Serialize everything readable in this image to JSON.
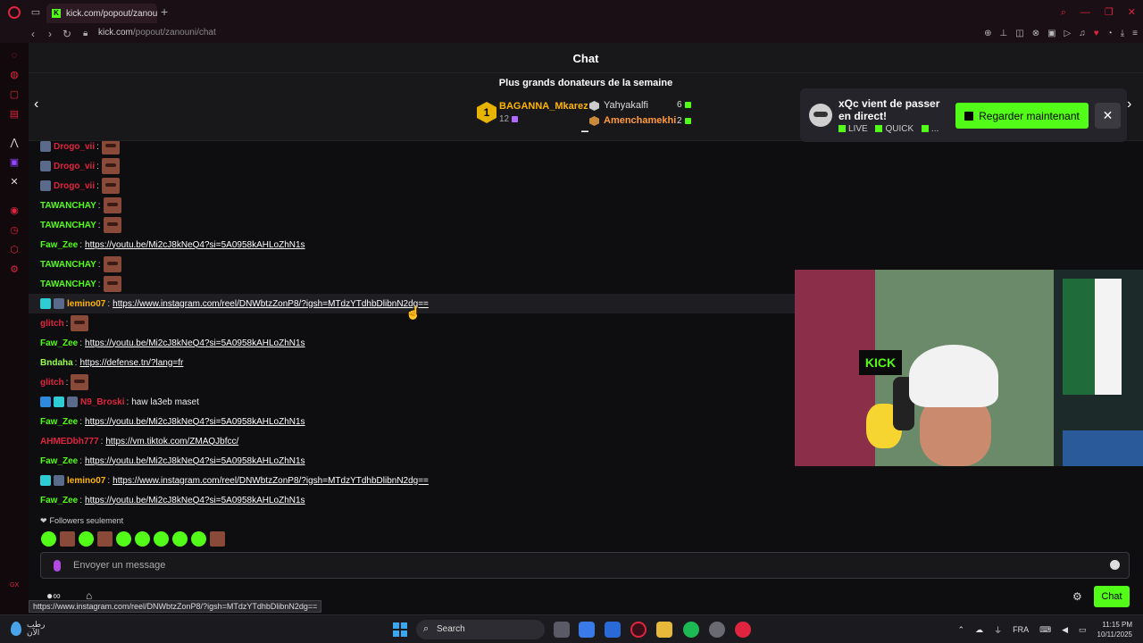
{
  "browser": {
    "tab_title": "kick.com/popout/zanouni",
    "tab_icon_letter": "K",
    "url_host": "kick.com",
    "url_path": "/popout/zanouni/chat"
  },
  "chat": {
    "title": "Chat",
    "donors_title": "Plus grands donateurs de la semaine",
    "top_donor": {
      "rank": "1",
      "name": "BAGANNA_Mkarez",
      "amount": "12"
    },
    "donor2": {
      "name": "Yahyakalfi",
      "amount": "6"
    },
    "donor3": {
      "name": "Amenchamekhi",
      "amount": "2"
    }
  },
  "notification": {
    "title": "xQc vient de passer en direct!",
    "subtitle_live": "LIVE",
    "subtitle_quick": "QUICK",
    "subtitle_more": "...",
    "watch_label": "Regarder maintenant",
    "close_glyph": "✕"
  },
  "messages": [
    {
      "user": "Drogo_vii",
      "color": "#e0243f",
      "badges": [
        "gray"
      ],
      "emote": true
    },
    {
      "user": "Drogo_vii",
      "color": "#e0243f",
      "badges": [
        "gray"
      ],
      "emote": true
    },
    {
      "user": "Drogo_vii",
      "color": "#e0243f",
      "badges": [
        "gray"
      ],
      "emote": true
    },
    {
      "user": "TAWANCHAY",
      "color": "#53fc18",
      "badges": [],
      "emote": true
    },
    {
      "user": "TAWANCHAY",
      "color": "#53fc18",
      "badges": [],
      "emote": true
    },
    {
      "user": "Faw_Zee",
      "color": "#53fc18",
      "badges": [],
      "link": "https://youtu.be/Mi2cJ8kNeQ4?si=5A0958kAHLoZhN1s"
    },
    {
      "user": "TAWANCHAY",
      "color": "#53fc18",
      "badges": [],
      "emote": true
    },
    {
      "user": "TAWANCHAY",
      "color": "#53fc18",
      "badges": [],
      "emote": true
    },
    {
      "user": "lemino07",
      "color": "#ffb400",
      "badges": [
        "teal",
        "gray"
      ],
      "link": "https://www.instagram.com/reel/DNWbtzZonP8/?igsh=MTdzYTdhbDlibnN2dg==",
      "highlight": true
    },
    {
      "user": "glitch",
      "color": "#e0243f",
      "badges": [],
      "emote": true
    },
    {
      "user": "Faw_Zee",
      "color": "#53fc18",
      "badges": [],
      "link": "https://youtu.be/Mi2cJ8kNeQ4?si=5A0958kAHLoZhN1s"
    },
    {
      "user": "Bndaha",
      "color": "#9aff4a",
      "badges": [],
      "link": "https://defense.tn/?lang=fr"
    },
    {
      "user": "glitch",
      "color": "#e0243f",
      "badges": [],
      "emote": true
    },
    {
      "user": "N9_Broski",
      "color": "#e0243f",
      "badges": [
        "blue",
        "teal",
        "gray"
      ],
      "text": "haw la3eb maset"
    },
    {
      "user": "Faw_Zee",
      "color": "#53fc18",
      "badges": [],
      "link": "https://youtu.be/Mi2cJ8kNeQ4?si=5A0958kAHLoZhN1s"
    },
    {
      "user": "AHMEDbh777",
      "color": "#e0243f",
      "badges": [],
      "link": "https://vm.tiktok.com/ZMAQJbfcc/"
    },
    {
      "user": "Faw_Zee",
      "color": "#53fc18",
      "badges": [],
      "link": "https://youtu.be/Mi2cJ8kNeQ4?si=5A0958kAHLoZhN1s"
    },
    {
      "user": "lemino07",
      "color": "#ffb400",
      "badges": [
        "teal",
        "gray"
      ],
      "link": "https://www.instagram.com/reel/DNWbtzZonP8/?igsh=MTdzYTdhbDlibnN2dg=="
    },
    {
      "user": "Faw_Zee",
      "color": "#53fc18",
      "badges": [],
      "link": "https://youtu.be/Mi2cJ8kNeQ4?si=5A0958kAHLoZhN1s"
    }
  ],
  "video": {
    "sign_text": "KICK"
  },
  "followers_label": "Followers seulement",
  "input": {
    "placeholder": "Envoyer un message"
  },
  "chat_button": "Chat",
  "status_url": "https://www.instagram.com/reel/DNWbtzZonP8/?igsh=MTdzYTdhbDlibnN2dg==",
  "taskbar": {
    "weather_line1": "رطب",
    "weather_line2": "الآن",
    "search_label": "Search",
    "lang": "FRA",
    "time": "11:15 PM",
    "date": "10/11/2025"
  },
  "colors": {
    "kick_green": "#53fc18",
    "opera_red": "#e0243f",
    "gold": "#ffb400"
  }
}
